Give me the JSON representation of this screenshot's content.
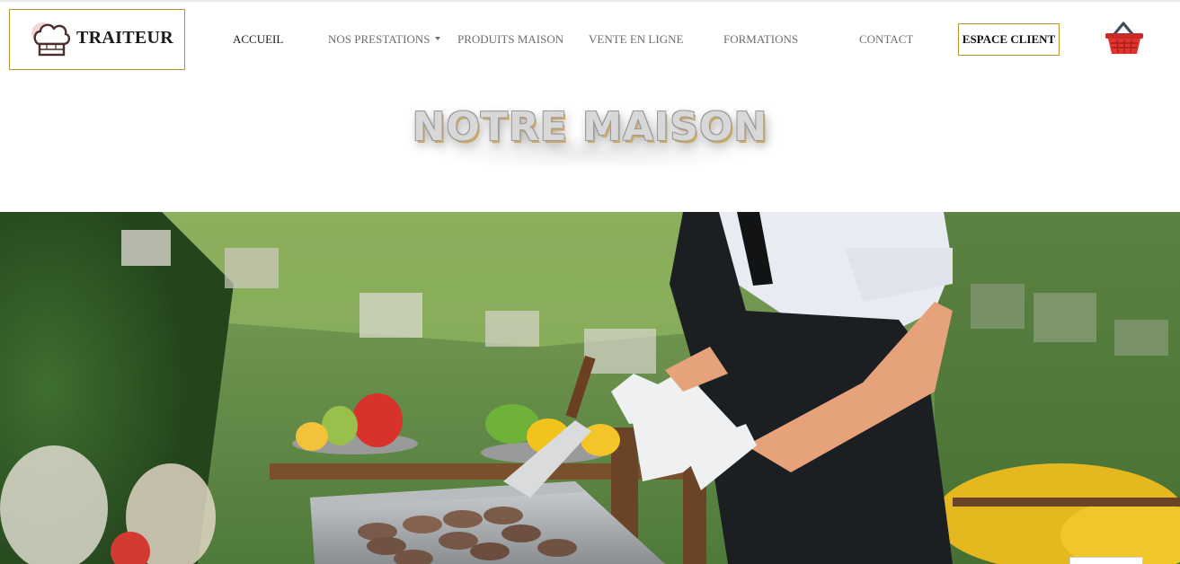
{
  "header": {
    "brand": "TRAITEUR",
    "nav": [
      {
        "label": "ACCUEIL",
        "active": true
      },
      {
        "label": "NOS PRESTATIONS",
        "has_dropdown": true
      },
      {
        "label": "PRODUITS MAISON"
      },
      {
        "label": "VENTE EN LIGNE"
      },
      {
        "label": "FORMATIONS"
      },
      {
        "label": "CONTACT"
      }
    ],
    "espace_client": "ESPACE CLIENT",
    "basket_icon": "shopping-basket-icon"
  },
  "page": {
    "title": "NOTRE MAISON"
  },
  "hero": {
    "image": "chef-grilling-burgers-outdoor-photo"
  },
  "colors": {
    "accent_gold": "#b8962e",
    "basket_red": "#d9312b",
    "nav_text": "#6e6e6e"
  }
}
